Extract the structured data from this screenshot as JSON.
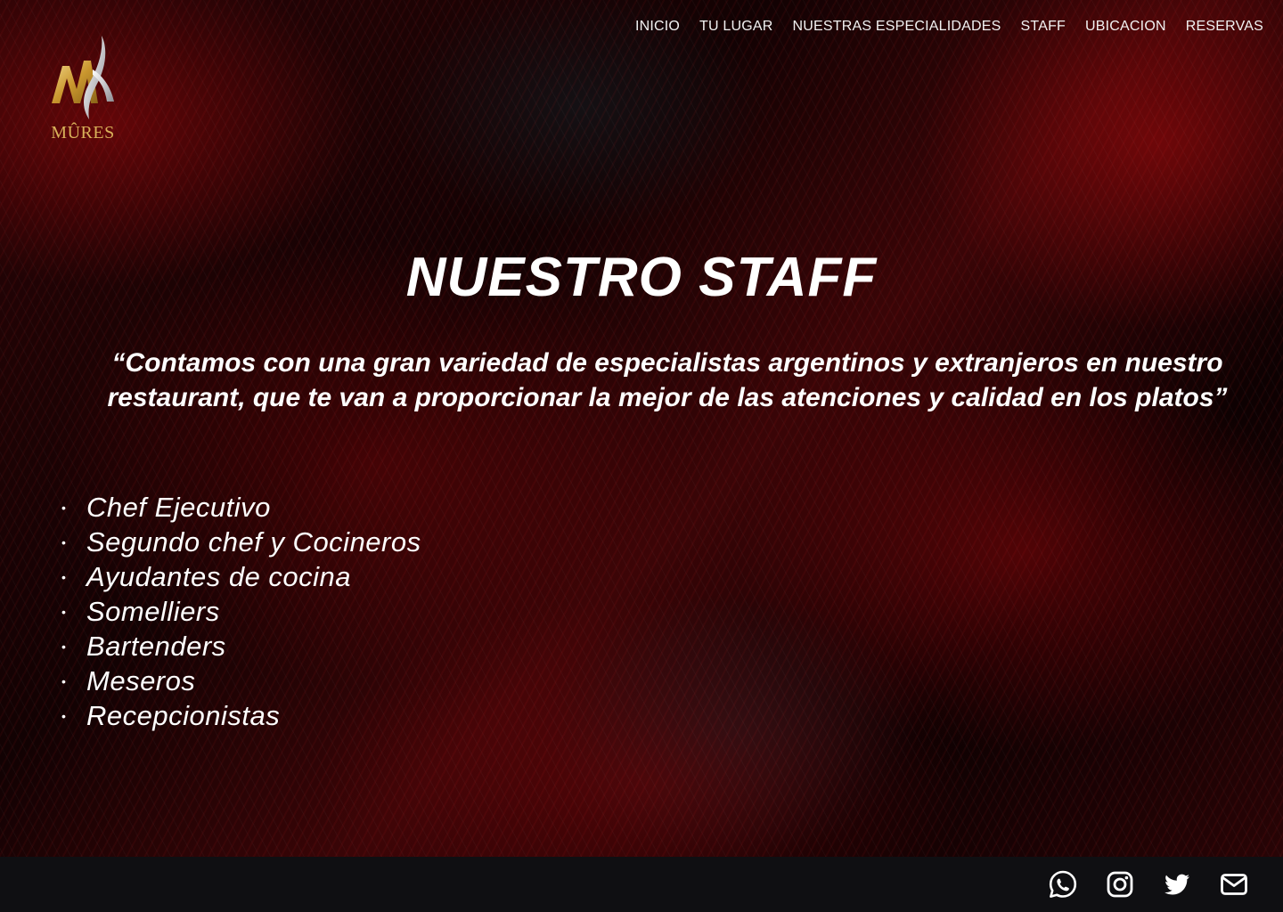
{
  "brand": {
    "name": "MÛRES",
    "logo_letter": "M",
    "accent_color": "#d9b25a"
  },
  "nav": {
    "items": [
      {
        "label": "INICIO"
      },
      {
        "label": "TU LUGAR"
      },
      {
        "label": "NUESTRAS ESPECIALIDADES"
      },
      {
        "label": "STAFF"
      },
      {
        "label": "UBICACION"
      },
      {
        "label": "RESERVAS"
      }
    ]
  },
  "main": {
    "title": "NUESTRO STAFF",
    "quote": "“Contamos con una gran variedad de especialistas argentinos y extranjeros en nuestro restaurant, que te van a proporcionar la mejor de las atenciones y calidad en los platos”",
    "bullet_char": "•",
    "staff": [
      "Chef Ejecutivo",
      "Segundo chef y Cocineros",
      "Ayudantes de cocina",
      "Somelliers",
      "Bartenders",
      "Meseros",
      "Recepcionistas"
    ]
  },
  "footer": {
    "background": "#0f0f12",
    "social_icons": [
      "whatsapp-icon",
      "instagram-icon",
      "twitter-icon",
      "email-icon"
    ]
  }
}
